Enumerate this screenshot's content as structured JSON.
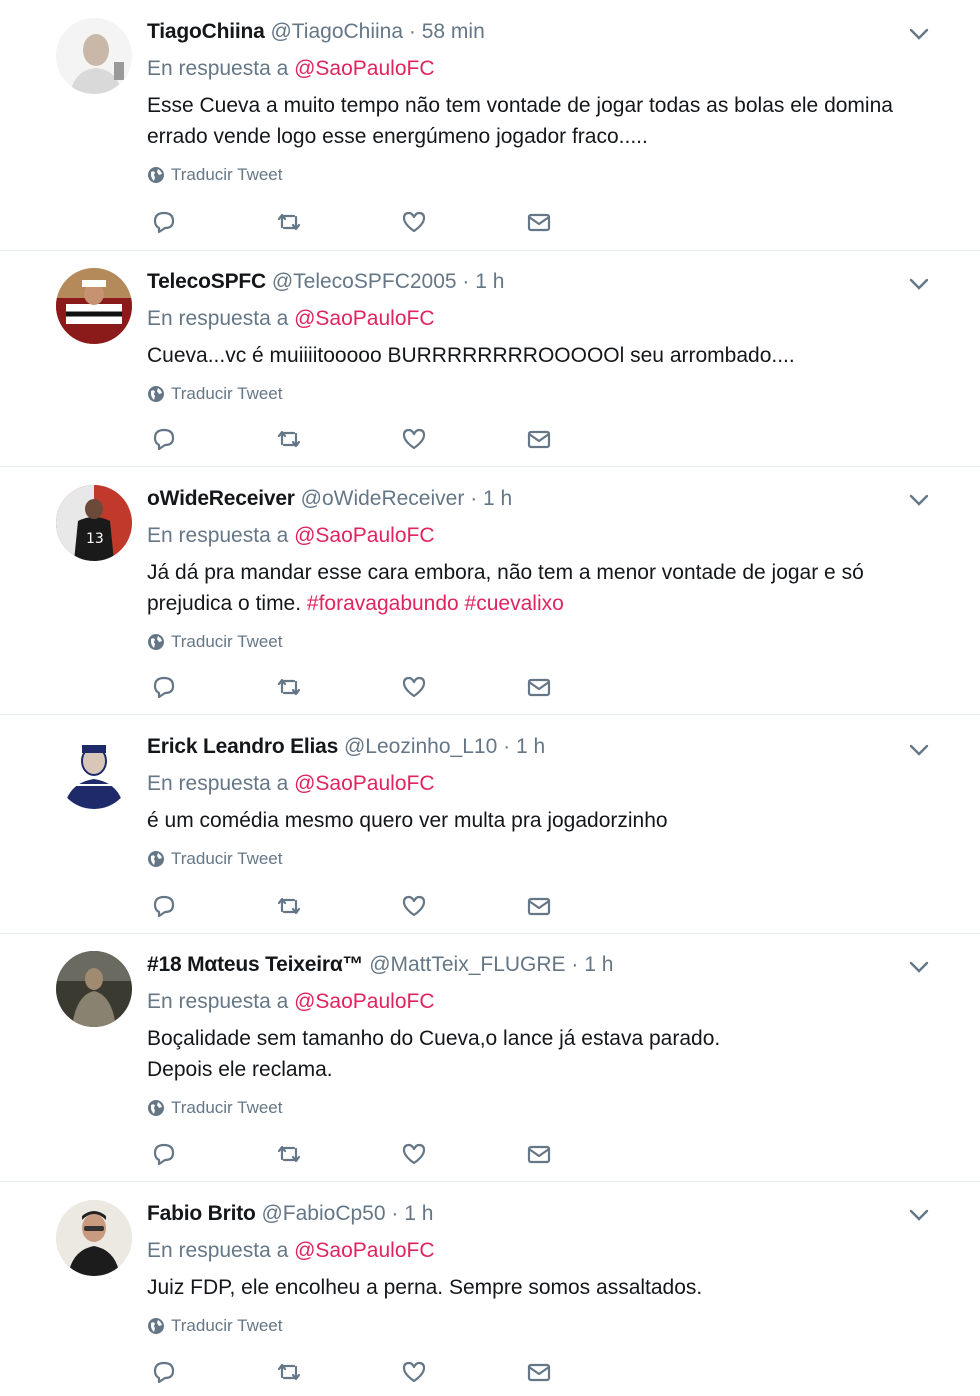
{
  "colors": {
    "accent": "#e0245e",
    "muted": "#657786",
    "text": "#14171a",
    "divider": "#e6ecf0"
  },
  "icons": {
    "reply": "reply-icon",
    "retweet": "retweet-icon",
    "like": "heart-icon",
    "dm": "envelope-icon",
    "translate": "globe-icon",
    "menu": "chevron-down-icon"
  },
  "tweets": [
    {
      "fullname": "TiagoChiina",
      "username": "@TiagoChiina",
      "dot": "·",
      "time": "58 min",
      "reply_prefix": "En respuesta a",
      "reply_to": "@SaoPauloFC",
      "text": "Esse Cueva a muito tempo não tem vontade de jogar todas as bolas ele domina\nerrado vende logo esse energúmeno jogador fraco.....",
      "hashtags": "",
      "translate": "Traducir Tweet"
    },
    {
      "fullname": "TelecoSPFC",
      "username": "@TelecoSPFC2005",
      "dot": "·",
      "time": "1 h",
      "reply_prefix": "En respuesta a",
      "reply_to": "@SaoPauloFC",
      "text": "Cueva...vc é muiiiitooooo BURRRRRRRROOOOOl seu arrombado....",
      "hashtags": "",
      "translate": "Traducir Tweet"
    },
    {
      "fullname": "oWideReceiver",
      "username": "@oWideReceiver",
      "dot": "·",
      "time": "1 h",
      "reply_prefix": "En respuesta a",
      "reply_to": "@SaoPauloFC",
      "text": "Já dá pra mandar esse cara embora, não tem a menor vontade de jogar e só\nprejudica o time. ",
      "hashtags": "#foravagabundo #cuevalixo",
      "translate": "Traducir Tweet"
    },
    {
      "fullname": "Erick Leandro Elias",
      "username": "@Leozinho_L10",
      "dot": "·",
      "time": "1 h",
      "reply_prefix": "En respuesta a",
      "reply_to": "@SaoPauloFC",
      "text": "é um comédia mesmo quero ver multa pra jogadorzinho",
      "hashtags": "",
      "translate": "Traducir Tweet"
    },
    {
      "fullname": "#18 Mαteus Teixeirα™",
      "username": "@MattTeix_FLUGRE",
      "dot": "·",
      "time": "1 h",
      "reply_prefix": "En respuesta a",
      "reply_to": "@SaoPauloFC",
      "text": "Boçalidade sem tamanho do Cueva,o lance já estava parado.\nDepois ele reclama.",
      "hashtags": "",
      "translate": "Traducir Tweet"
    },
    {
      "fullname": "Fabio Brito",
      "username": "@FabioCp50",
      "dot": "·",
      "time": "1 h",
      "reply_prefix": "En respuesta a",
      "reply_to": "@SaoPauloFC",
      "text": "Juiz FDP, ele encolheu a perna. Sempre somos assaltados.",
      "hashtags": "",
      "translate": "Traducir Tweet"
    }
  ]
}
